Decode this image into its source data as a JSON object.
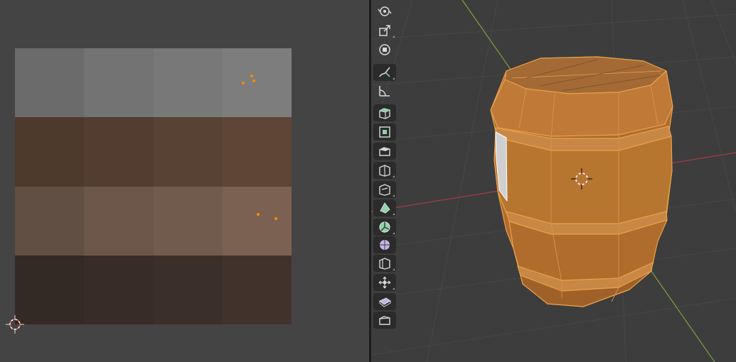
{
  "uv_editor": {
    "palette_rows": [
      [
        "#6b6b6b",
        "#737373",
        "#787878",
        "#7d7d7d"
      ],
      [
        "#4e392d",
        "#533d30",
        "#574234",
        "#5e4636"
      ],
      [
        "#624f43",
        "#6c574a",
        "#715b4d",
        "#7a6151"
      ],
      [
        "#332925",
        "#372c27",
        "#3b2f29",
        "#41332c"
      ]
    ],
    "cursor_icon": "2d-cursor-icon"
  },
  "toolbar": {
    "tools": [
      {
        "icon": "rotate-view-icon"
      },
      {
        "icon": "scale-icon"
      },
      {
        "icon": "transform-icon"
      },
      {
        "icon": "annotate-icon"
      },
      {
        "icon": "measure-icon"
      },
      {
        "icon": "add-cube-icon"
      },
      {
        "icon": "extrude-region-icon"
      },
      {
        "icon": "inset-faces-icon"
      },
      {
        "icon": "bevel-icon"
      },
      {
        "icon": "loop-cut-icon"
      },
      {
        "icon": "knife-icon"
      },
      {
        "icon": "poly-build-icon"
      },
      {
        "icon": "spin-icon"
      },
      {
        "icon": "smooth-icon"
      },
      {
        "icon": "edge-slide-icon"
      },
      {
        "icon": "shrink-fatten-icon"
      },
      {
        "icon": "shear-icon"
      },
      {
        "icon": "rip-region-icon"
      }
    ]
  },
  "viewport": {
    "object": "barrel",
    "accent_color": "#e8a04a",
    "selected_face_color": "#c4843f",
    "x_axis_color": "#a83b47",
    "y_axis_color": "#7da13f"
  }
}
